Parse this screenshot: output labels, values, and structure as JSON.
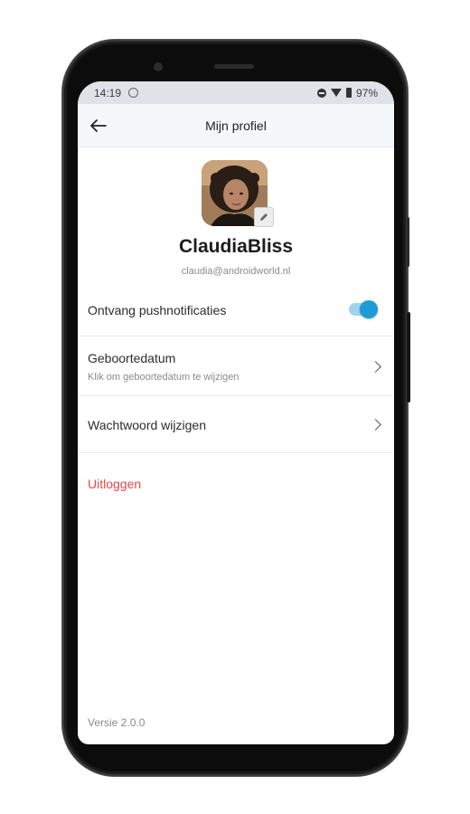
{
  "status_bar": {
    "time": "14:19",
    "battery": "97%",
    "icons": [
      "sync-icon",
      "do-not-disturb-icon",
      "wifi-icon",
      "battery-icon"
    ]
  },
  "app_bar": {
    "title": "Mijn profiel",
    "back_icon": "arrow-left-icon"
  },
  "profile": {
    "username": "ClaudiaBliss",
    "email": "claudia@androidworld.nl",
    "edit_icon": "pencil-icon"
  },
  "settings": {
    "push": {
      "label": "Ontvang pushnotificaties",
      "enabled": true
    },
    "birthday": {
      "label": "Geboortedatum",
      "sublabel": "Klik om geboortedatum te wijzigen"
    },
    "password": {
      "label": "Wachtwoord wijzigen"
    }
  },
  "logout_label": "Uitloggen",
  "version": "Versie 2.0.0",
  "colors": {
    "accent": "#1e9bd6",
    "logout": "#e24a4a",
    "appbar_bg": "#f4f8fb",
    "statusbar_bg": "#dfe3e8"
  }
}
